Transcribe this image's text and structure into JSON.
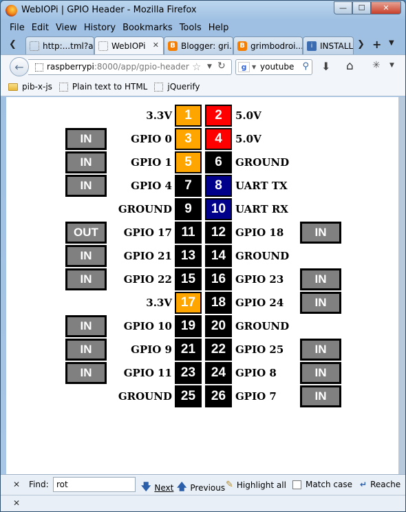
{
  "window": {
    "title": "WebIOPi | GPIO Header - Mozilla Firefox",
    "buttons": {
      "minimize": "—",
      "maximize": "☐",
      "close": "✕"
    }
  },
  "menu": [
    "File",
    "Edit",
    "View",
    "History",
    "Bookmarks",
    "Tools",
    "Help"
  ],
  "tabs": [
    {
      "label": "http:...tml?a",
      "icon": "page-icon",
      "active": false
    },
    {
      "label": "WebIOPi",
      "icon": "page-icon",
      "active": true
    },
    {
      "label": "Blogger: gri...",
      "icon": "blogger-icon",
      "active": false
    },
    {
      "label": "grimbodroi...",
      "icon": "blogger-icon",
      "active": false
    },
    {
      "label": "INSTALL - ...",
      "icon": "install-icon",
      "active": false
    }
  ],
  "nav": {
    "url_host": "raspberrypi",
    "url_rest": ":8000/app/gpio-header",
    "search_engine": "g",
    "search_text": "youtube r"
  },
  "bookmarks": [
    {
      "label": "pib-x-js",
      "icon": "folder-icon"
    },
    {
      "label": "Plain text to HTML",
      "icon": "page-icon"
    },
    {
      "label": "jQuerify",
      "icon": "page-icon"
    }
  ],
  "header_rows": [
    {
      "left_io": "",
      "left_label": "3.3V",
      "left_pin": "1",
      "left_color": "orange",
      "right_pin": "2",
      "right_color": "red",
      "right_label": "5.0V",
      "right_io": ""
    },
    {
      "left_io": "IN",
      "left_label": "GPIO 0",
      "left_pin": "3",
      "left_color": "orange",
      "right_pin": "4",
      "right_color": "red",
      "right_label": "5.0V",
      "right_io": ""
    },
    {
      "left_io": "IN",
      "left_label": "GPIO 1",
      "left_pin": "5",
      "left_color": "orange",
      "right_pin": "6",
      "right_color": "black",
      "right_label": "GROUND",
      "right_io": ""
    },
    {
      "left_io": "IN",
      "left_label": "GPIO 4",
      "left_pin": "7",
      "left_color": "black",
      "right_pin": "8",
      "right_color": "navy",
      "right_label": "UART TX",
      "right_io": ""
    },
    {
      "left_io": "",
      "left_label": "GROUND",
      "left_pin": "9",
      "left_color": "black",
      "right_pin": "10",
      "right_color": "navy",
      "right_label": "UART RX",
      "right_io": ""
    },
    {
      "left_io": "OUT",
      "left_label": "GPIO 17",
      "left_pin": "11",
      "left_color": "black",
      "right_pin": "12",
      "right_color": "black",
      "right_label": "GPIO 18",
      "right_io": "IN"
    },
    {
      "left_io": "IN",
      "left_label": "GPIO 21",
      "left_pin": "13",
      "left_color": "black",
      "right_pin": "14",
      "right_color": "black",
      "right_label": "GROUND",
      "right_io": ""
    },
    {
      "left_io": "IN",
      "left_label": "GPIO 22",
      "left_pin": "15",
      "left_color": "black",
      "right_pin": "16",
      "right_color": "black",
      "right_label": "GPIO 23",
      "right_io": "IN"
    },
    {
      "left_io": "",
      "left_label": "3.3V",
      "left_pin": "17",
      "left_color": "orange",
      "right_pin": "18",
      "right_color": "black",
      "right_label": "GPIO 24",
      "right_io": "IN"
    },
    {
      "left_io": "IN",
      "left_label": "GPIO 10",
      "left_pin": "19",
      "left_color": "black",
      "right_pin": "20",
      "right_color": "black",
      "right_label": "GROUND",
      "right_io": ""
    },
    {
      "left_io": "IN",
      "left_label": "GPIO 9",
      "left_pin": "21",
      "left_color": "black",
      "right_pin": "22",
      "right_color": "black",
      "right_label": "GPIO 25",
      "right_io": "IN"
    },
    {
      "left_io": "IN",
      "left_label": "GPIO 11",
      "left_pin": "23",
      "left_color": "black",
      "right_pin": "24",
      "right_color": "black",
      "right_label": "GPIO 8",
      "right_io": "IN"
    },
    {
      "left_io": "",
      "left_label": "GROUND",
      "left_pin": "25",
      "left_color": "black",
      "right_pin": "26",
      "right_color": "black",
      "right_label": "GPIO 7",
      "right_io": "IN"
    }
  ],
  "colors": {
    "orange": "#ffa500",
    "red": "#ff0000",
    "black": "#000000",
    "navy": "#00008b",
    "io_button": "#808080"
  },
  "findbar": {
    "label": "Find:",
    "value": "rot",
    "next": "Next",
    "previous": "Previous",
    "highlight": "Highlight all",
    "match_case": "Match case",
    "reached": "Reache"
  }
}
